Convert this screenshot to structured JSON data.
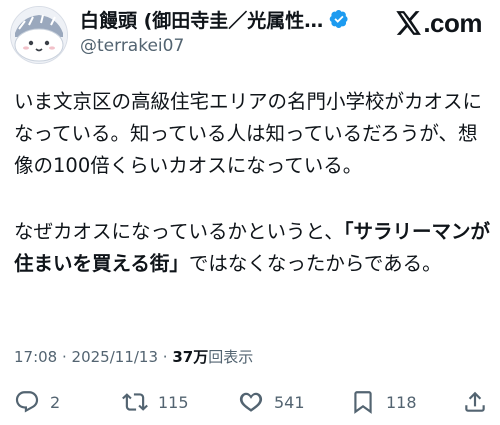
{
  "author": {
    "display_name": "白饅頭 (御田寺圭／光属性…",
    "handle": "@terrakei07",
    "verified": true
  },
  "brand": {
    "logo_text": ".com"
  },
  "tweet": {
    "paragraph1": "いま文京区の高級住宅エリアの名門小学校がカオスになっている。知っている人は知っているだろうが、想像の100倍くらいカオスになっている。",
    "paragraph2_before": "なぜカオスになっているかというと、",
    "paragraph2_emphasis": "「サラリーマンが住まいを買える街」",
    "paragraph2_after": "ではなくなったからである。"
  },
  "meta": {
    "time": "17:08",
    "separator1": " · ",
    "date": "2025/11/13",
    "separator2": " · ",
    "views_count": "37万",
    "views_label": "回表示"
  },
  "actions": {
    "replies": "2",
    "reposts": "115",
    "likes": "541",
    "bookmarks": "118"
  },
  "icons": {
    "verified": "verified-badge-icon",
    "reply": "reply-icon",
    "repost": "repost-icon",
    "like": "heart-icon",
    "bookmark": "bookmark-icon",
    "share": "share-icon"
  },
  "colors": {
    "verified": "#1d9bf0",
    "text": "#0f1419",
    "secondary": "#536471"
  }
}
